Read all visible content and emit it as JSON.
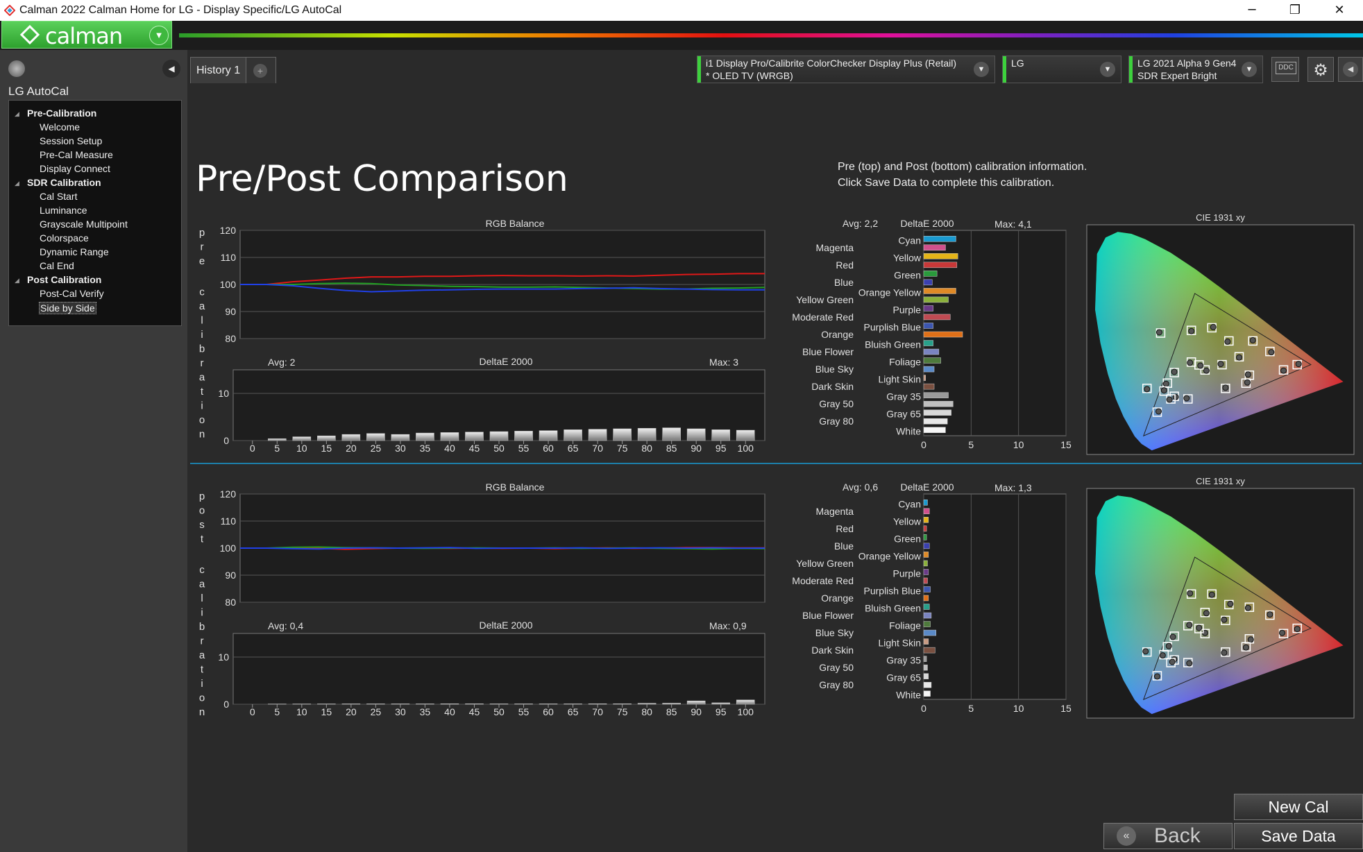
{
  "window": {
    "title": "Calman 2022 Calman Home for LG  - Display Specific/LG AutoCal",
    "controls": [
      "─",
      "❐",
      "✕"
    ]
  },
  "header": {
    "logo_text": "calman"
  },
  "left_panel": {
    "title": "LG AutoCal",
    "groups": [
      {
        "label": "Pre-Calibration",
        "items": [
          "Welcome",
          "Session Setup",
          "Pre-Cal Measure",
          "Display  Connect"
        ]
      },
      {
        "label": "SDR Calibration",
        "items": [
          "Cal Start",
          "Luminance",
          "Grayscale Multipoint",
          "Colorspace",
          "Dynamic Range",
          "Cal End"
        ]
      },
      {
        "label": "Post Calibration",
        "items": [
          "Post-Cal Verify",
          "Side by Side"
        ]
      }
    ],
    "selected": "Side by Side"
  },
  "tabs": [
    {
      "label": "History 1"
    }
  ],
  "device_selectors": {
    "meter": {
      "line1": "i1 Display Pro/Calibrite ColorChecker Display Plus (Retail)",
      "line2": "* OLED TV (WRGB)"
    },
    "brand": {
      "line1": "LG",
      "line2": ""
    },
    "display": {
      "line1": "LG 2021 Alpha 9 Gen4",
      "line2": "SDR Expert Bright"
    },
    "ddc_label": "DDC"
  },
  "page": {
    "title": "Pre/Post Comparison",
    "info_line1": "Pre (top) and Post (bottom) calibration information.",
    "info_line2": "Click Save Data to complete this calibration."
  },
  "buttons": {
    "new_cal": "New Cal",
    "back": "Back",
    "save_data": "Save Data"
  },
  "chart_data": [
    {
      "panel": "pre",
      "side_label": "pre calibration",
      "type": "line",
      "title": "RGB Balance",
      "x": [
        0,
        5,
        10,
        15,
        20,
        25,
        30,
        35,
        40,
        45,
        50,
        55,
        60,
        65,
        70,
        75,
        80,
        85,
        90,
        95,
        100
      ],
      "ylim": [
        80,
        120
      ],
      "yticks": [
        80,
        90,
        100,
        110,
        120
      ],
      "series": [
        {
          "color": "#e01818",
          "values": [
            100,
            100,
            101,
            101.6,
            102.3,
            102.8,
            102.8,
            103.0,
            103.0,
            103.2,
            103.3,
            103.2,
            103.2,
            103.1,
            103.2,
            103.1,
            103.4,
            103.7,
            103.8,
            104.0,
            104.0
          ]
        },
        {
          "color": "#22a022",
          "values": [
            100,
            100,
            100,
            100.3,
            100.5,
            100.3,
            99.8,
            99.6,
            99.3,
            99.2,
            99.0,
            99.0,
            99.1,
            98.9,
            98.7,
            98.5,
            98.3,
            98.3,
            98.6,
            98.7,
            98.9
          ]
        },
        {
          "color": "#2040e8",
          "values": [
            100,
            100,
            99.5,
            98.6,
            97.8,
            97.3,
            97.6,
            97.9,
            98.0,
            98.2,
            98.3,
            98.3,
            98.3,
            98.5,
            98.6,
            98.8,
            98.5,
            98.3,
            98.1,
            98.0,
            98.0
          ]
        }
      ]
    },
    {
      "panel": "pre",
      "type": "bar",
      "title": "DeltaE 2000",
      "avg_label": "Avg: 2",
      "max_label": "Max: 3",
      "x": [
        0,
        5,
        10,
        15,
        20,
        25,
        30,
        35,
        40,
        45,
        50,
        55,
        60,
        65,
        70,
        75,
        80,
        85,
        90,
        95,
        100
      ],
      "values": [
        0,
        0.4,
        0.8,
        1.0,
        1.3,
        1.5,
        1.3,
        1.6,
        1.7,
        1.8,
        1.9,
        2.0,
        2.1,
        2.3,
        2.4,
        2.5,
        2.6,
        2.7,
        2.5,
        2.3,
        2.2
      ],
      "ylim": [
        0,
        15
      ],
      "yticks": [
        0,
        10
      ]
    },
    {
      "panel": "pre",
      "type": "bar",
      "orientation": "horizontal",
      "title": "DeltaE 2000",
      "avg_label": "Avg: 2,2",
      "max_label": "Max: 4,1",
      "xlim": [
        0,
        15
      ],
      "xticks": [
        0,
        5,
        10,
        15
      ],
      "categories": [
        "Cyan",
        "Magenta",
        "Yellow",
        "Red",
        "Green",
        "Blue",
        "Orange Yellow",
        "Yellow Green",
        "Purple",
        "Moderate Red",
        "Purplish Blue",
        "Orange",
        "Bluish Green",
        "Blue Flower",
        "Foliage",
        "Blue Sky",
        "Light Skin",
        "Dark Skin",
        "Gray 35",
        "Gray 50",
        "Gray 65",
        "Gray 80",
        "White"
      ],
      "values": [
        3.4,
        2.3,
        3.6,
        3.5,
        1.4,
        0.9,
        3.4,
        2.6,
        1.0,
        2.8,
        1.0,
        4.1,
        1.0,
        1.6,
        1.8,
        1.1,
        0.2,
        1.1,
        2.6,
        3.1,
        2.9,
        2.5,
        2.3
      ],
      "colors": [
        "#1a9ad0",
        "#d0508c",
        "#e4b418",
        "#c83838",
        "#2a9a3c",
        "#3a40b0",
        "#e08a26",
        "#8ab03a",
        "#6a3a88",
        "#c04a52",
        "#3c56b0",
        "#e07018",
        "#28a08a",
        "#7a84c0",
        "#4e7a3c",
        "#5a8ac8",
        "#c89a82",
        "#7a5040",
        "#9a9a9a",
        "#c0c0c0",
        "#d8d8d8",
        "#e8e8e8",
        "#f6f6f6"
      ]
    },
    {
      "panel": "pre",
      "type": "scatter",
      "title": "CIE 1931 xy",
      "points": [
        [
          0.2,
          0.45
        ],
        [
          0.29,
          0.46
        ],
        [
          0.35,
          0.47
        ],
        [
          0.4,
          0.42
        ],
        [
          0.47,
          0.42
        ],
        [
          0.52,
          0.38
        ],
        [
          0.38,
          0.33
        ],
        [
          0.43,
          0.36
        ],
        [
          0.6,
          0.33
        ],
        [
          0.29,
          0.34
        ],
        [
          0.24,
          0.3
        ],
        [
          0.33,
          0.31
        ],
        [
          0.46,
          0.29
        ],
        [
          0.56,
          0.31
        ],
        [
          0.45,
          0.26
        ],
        [
          0.22,
          0.26
        ],
        [
          0.21,
          0.23
        ],
        [
          0.24,
          0.21
        ],
        [
          0.28,
          0.2
        ],
        [
          0.16,
          0.24
        ],
        [
          0.19,
          0.15
        ],
        [
          0.23,
          0.2
        ],
        [
          0.39,
          0.24
        ],
        [
          0.3125,
          0.329
        ]
      ]
    },
    {
      "panel": "post",
      "side_label": "post calibration",
      "type": "line",
      "title": "RGB Balance",
      "x": [
        0,
        5,
        10,
        15,
        20,
        25,
        30,
        35,
        40,
        45,
        50,
        55,
        60,
        65,
        70,
        75,
        80,
        85,
        90,
        95,
        100
      ],
      "ylim": [
        80,
        120
      ],
      "yticks": [
        80,
        90,
        100,
        110,
        120
      ],
      "series": [
        {
          "color": "#e01818",
          "values": [
            100,
            100,
            100,
            99.9,
            99.6,
            99.8,
            100,
            100,
            99.9,
            100,
            99.9,
            100,
            99.8,
            100,
            100.1,
            99.9,
            100,
            100.2,
            100.2,
            100.1,
            100.1
          ]
        },
        {
          "color": "#22a022",
          "values": [
            100,
            100,
            100.3,
            100.4,
            100.2,
            100.1,
            100,
            99.9,
            100,
            100.1,
            100,
            100,
            100.1,
            99.9,
            100,
            100.1,
            99.9,
            99.8,
            99.7,
            99.9,
            99.8
          ]
        },
        {
          "color": "#2040e8",
          "values": [
            100,
            100,
            99.8,
            99.7,
            100,
            100.1,
            100,
            100.1,
            100.2,
            99.9,
            100,
            100,
            100,
            100.1,
            99.9,
            100,
            100.1,
            100,
            100.1,
            100,
            100
          ]
        }
      ]
    },
    {
      "panel": "post",
      "type": "bar",
      "title": "DeltaE 2000",
      "avg_label": "Avg: 0,4",
      "max_label": "Max: 0,9",
      "x": [
        0,
        5,
        10,
        15,
        20,
        25,
        30,
        35,
        40,
        45,
        50,
        55,
        60,
        65,
        70,
        75,
        80,
        85,
        90,
        95,
        100
      ],
      "values": [
        0,
        0.05,
        0.06,
        0.07,
        0.08,
        0.08,
        0.08,
        0.08,
        0.1,
        0.1,
        0.08,
        0.08,
        0.08,
        0.08,
        0.1,
        0.1,
        0.2,
        0.22,
        0.7,
        0.3,
        0.9
      ],
      "ylim": [
        0,
        15
      ],
      "yticks": [
        0,
        10
      ]
    },
    {
      "panel": "post",
      "type": "bar",
      "orientation": "horizontal",
      "title": "DeltaE 2000",
      "avg_label": "Avg: 0,6",
      "max_label": "Max: 1,3",
      "xlim": [
        0,
        15
      ],
      "xticks": [
        0,
        5,
        10,
        15
      ],
      "categories": [
        "Cyan",
        "Magenta",
        "Yellow",
        "Red",
        "Green",
        "Blue",
        "Orange Yellow",
        "Yellow Green",
        "Purple",
        "Moderate Red",
        "Purplish Blue",
        "Orange",
        "Bluish Green",
        "Blue Flower",
        "Foliage",
        "Blue Sky",
        "Light Skin",
        "Dark Skin",
        "Gray 35",
        "Gray 50",
        "Gray 65",
        "Gray 80",
        "White"
      ],
      "values": [
        0.4,
        0.6,
        0.5,
        0.3,
        0.3,
        0.6,
        0.5,
        0.4,
        0.5,
        0.4,
        0.7,
        0.5,
        0.6,
        0.8,
        0.7,
        1.3,
        0.5,
        1.2,
        0.3,
        0.4,
        0.5,
        0.8,
        0.7
      ],
      "colors": [
        "#1a9ad0",
        "#d0508c",
        "#e4b418",
        "#c83838",
        "#2a9a3c",
        "#3a40b0",
        "#e08a26",
        "#8ab03a",
        "#6a3a88",
        "#c04a52",
        "#3c56b0",
        "#e07018",
        "#28a08a",
        "#7a84c0",
        "#4e7a3c",
        "#5a8ac8",
        "#c89a82",
        "#7a5040",
        "#9a9a9a",
        "#c0c0c0",
        "#d8d8d8",
        "#e8e8e8",
        "#f6f6f6"
      ]
    },
    {
      "panel": "post",
      "type": "scatter",
      "title": "CIE 1931 xy",
      "points": [
        [
          0.29,
          0.46
        ],
        [
          0.35,
          0.46
        ],
        [
          0.4,
          0.42
        ],
        [
          0.46,
          0.41
        ],
        [
          0.52,
          0.38
        ],
        [
          0.33,
          0.39
        ],
        [
          0.39,
          0.36
        ],
        [
          0.6,
          0.33
        ],
        [
          0.28,
          0.34
        ],
        [
          0.24,
          0.3
        ],
        [
          0.33,
          0.31
        ],
        [
          0.46,
          0.29
        ],
        [
          0.56,
          0.31
        ],
        [
          0.45,
          0.26
        ],
        [
          0.22,
          0.26
        ],
        [
          0.21,
          0.23
        ],
        [
          0.24,
          0.21
        ],
        [
          0.28,
          0.2
        ],
        [
          0.16,
          0.24
        ],
        [
          0.19,
          0.15
        ],
        [
          0.23,
          0.2
        ],
        [
          0.39,
          0.24
        ],
        [
          0.3125,
          0.329
        ]
      ]
    }
  ]
}
